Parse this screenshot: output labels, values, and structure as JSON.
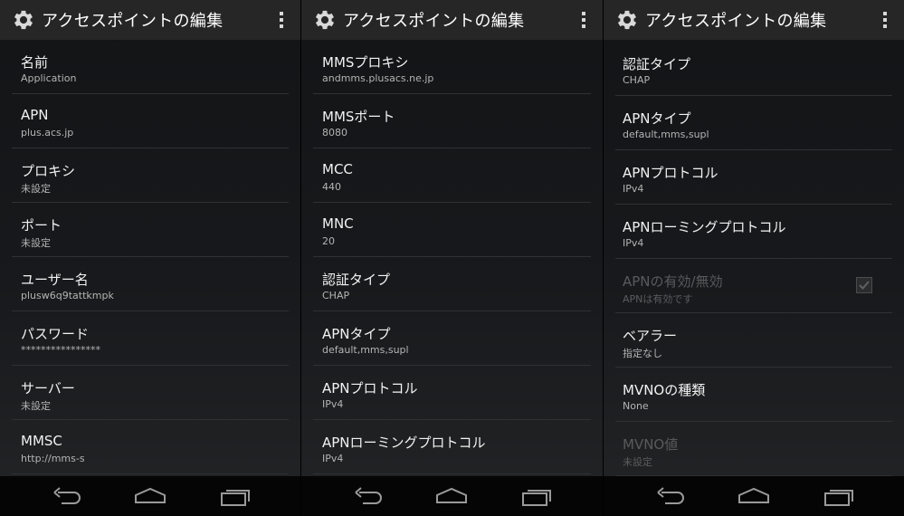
{
  "panels": [
    {
      "title": "アクセスポイントの編集",
      "items": [
        {
          "label": "名前",
          "value": "Application"
        },
        {
          "label": "APN",
          "value": "plus.acs.jp"
        },
        {
          "label": "プロキシ",
          "value": "未設定"
        },
        {
          "label": "ポート",
          "value": "未設定"
        },
        {
          "label": "ユーザー名",
          "value": "plusw6q9tattkmpk"
        },
        {
          "label": "パスワード",
          "value": "****************"
        },
        {
          "label": "サーバー",
          "value": "未設定"
        },
        {
          "label": "MMSC",
          "value": "http://mms-s"
        }
      ]
    },
    {
      "title": "アクセスポイントの編集",
      "items": [
        {
          "label": "MMSプロキシ",
          "value": "andmms.plusacs.ne.jp"
        },
        {
          "label": "MMSポート",
          "value": "8080"
        },
        {
          "label": "MCC",
          "value": "440"
        },
        {
          "label": "MNC",
          "value": "20"
        },
        {
          "label": "認証タイプ",
          "value": "CHAP"
        },
        {
          "label": "APNタイプ",
          "value": "default,mms,supl"
        },
        {
          "label": "APNプロトコル",
          "value": "IPv4"
        },
        {
          "label": "APNローミングプロトコル",
          "value": "IPv4"
        }
      ]
    },
    {
      "title": "アクセスポイントの編集",
      "items": [
        {
          "label": "認証タイプ",
          "value": "CHAP"
        },
        {
          "label": "APNタイプ",
          "value": "default,mms,supl"
        },
        {
          "label": "APNプロトコル",
          "value": "IPv4"
        },
        {
          "label": "APNローミングプロトコル",
          "value": "IPv4"
        },
        {
          "label": "APNの有効/無効",
          "value": "APNは有効です",
          "checked": true
        },
        {
          "label": "ベアラー",
          "value": "指定なし"
        },
        {
          "label": "MVNOの種類",
          "value": "None"
        },
        {
          "label": "MVNO値",
          "value": "未設定"
        }
      ]
    }
  ],
  "colors": {
    "action_bar": "#262626",
    "nav_bar": "#050505",
    "divider": "#2f3234",
    "label": "#f2f2f2",
    "value": "#b4b4b4",
    "disabled": "#585a5c"
  },
  "icons": {
    "title": "settings-gear-icon",
    "menu": "overflow-menu-icon",
    "back": "back-icon",
    "home": "home-icon",
    "recents": "recent-apps-icon",
    "check": "checkbox-checked-icon"
  }
}
